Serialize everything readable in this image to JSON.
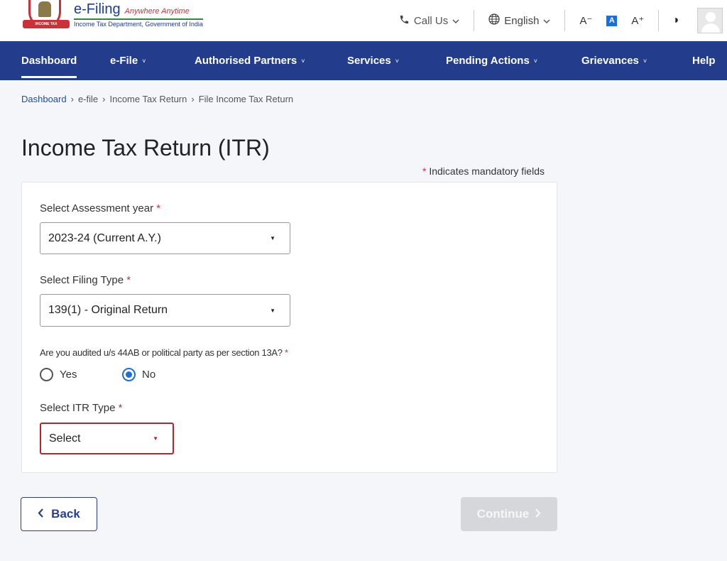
{
  "header": {
    "brand_name": "e-Filing",
    "brand_tagline": "Anywhere Anytime",
    "brand_subtitle": "Income Tax Department, Government of India",
    "emblem_text": "INCOME TAX DEPARTMENT",
    "call_us": "Call Us",
    "language": "English",
    "font_decrease": "A⁻",
    "font_default": "A",
    "font_increase": "A⁺",
    "contrast_icon": "◑"
  },
  "nav": {
    "items": [
      {
        "label": "Dashboard",
        "dropdown": false,
        "active": true
      },
      {
        "label": "e-File",
        "dropdown": true
      },
      {
        "label": "Authorised Partners",
        "dropdown": true
      },
      {
        "label": "Services",
        "dropdown": true
      },
      {
        "label": "Pending Actions",
        "dropdown": true
      },
      {
        "label": "Grievances",
        "dropdown": true
      },
      {
        "label": "Help",
        "dropdown": false
      }
    ]
  },
  "breadcrumb": {
    "items": [
      "Dashboard",
      "e-file",
      "Income Tax Return",
      "File Income Tax Return"
    ]
  },
  "page": {
    "title": "Income Tax Return (ITR)",
    "mandatory_note": "Indicates mandatory fields",
    "required_marker": "*"
  },
  "form": {
    "assessment_year": {
      "label": "Select Assessment year",
      "value": "2023-24 (Current A.Y.)"
    },
    "filing_type": {
      "label": "Select Filing Type",
      "value": "139(1) - Original Return"
    },
    "audit_question": {
      "label": "Are you audited u/s 44AB or political party as per section 13A?",
      "options": [
        "Yes",
        "No"
      ],
      "selected": "No"
    },
    "itr_type": {
      "label": "Select ITR Type",
      "value": "Select"
    }
  },
  "buttons": {
    "back": "Back",
    "continue": "Continue"
  },
  "colors": {
    "nav_bg": "#233c8c",
    "required": "#c8333a",
    "radio_selected": "#1d6fd6",
    "error_border": "#b3262e",
    "disabled_button": "#d6d7db"
  }
}
